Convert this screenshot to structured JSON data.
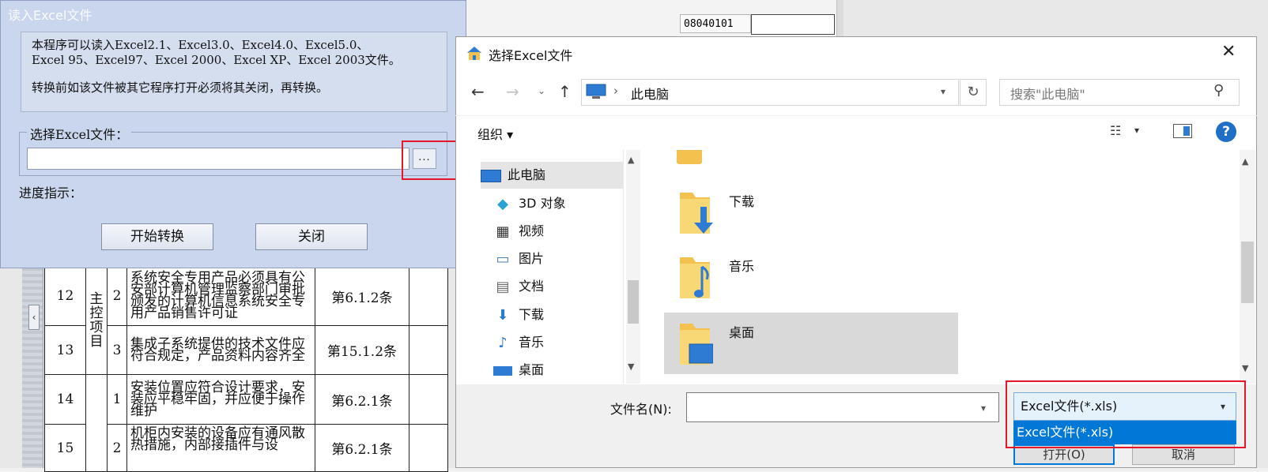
{
  "background": {
    "code_cell": "08040101",
    "table_rows": [
      {
        "no": "12",
        "category": "主\n控\n项\n目",
        "seq": "2",
        "desc": "系统安全专用产品必须具有公安部计算机管理监察部门审批颁发的计算机信息系统安全专用产品销售许可证",
        "ref": "第6.1.2条"
      },
      {
        "no": "13",
        "category": "",
        "seq": "3",
        "desc": "集成子系统提供的技术文件应符合规定，产品资料内容齐全",
        "ref": "第15.1.2条"
      },
      {
        "no": "14",
        "category": "",
        "seq": "1",
        "desc": "安装位置应符合设计要求，安装应平稳牢固，并应便于操作维护",
        "ref": "第6.2.1条"
      },
      {
        "no": "15",
        "category": "",
        "seq": "2",
        "desc": "机柜内安装的设备应有通风散热措施，内部接插件与设",
        "ref": "第6.2.1条"
      }
    ]
  },
  "excel_dialog": {
    "title": "读入Excel文件",
    "info_line1": "本程序可以读入Excel2.1、Excel3.0、Excel4.0、Excel5.0、",
    "info_line2": "Excel 95、Excel97、Excel 2000、Excel XP、Excel 2003文件。",
    "info_line3": "转换前如该文件被其它程序打开必须将其关闭，再转换。",
    "group_label": "选择Excel文件：",
    "file_path": "",
    "browse_label": "...",
    "progress_label": "进度指示：",
    "start_button": "开始转换",
    "close_button": "关闭"
  },
  "file_dialog": {
    "title": "选择Excel文件",
    "close_glyph": "✕",
    "address": "此电脑",
    "search_placeholder": "搜索\"此电脑\"",
    "organize": "组织 ▾",
    "nav_items": [
      {
        "label": "此电脑",
        "icon": "computer-icon"
      },
      {
        "label": "3D 对象",
        "icon": "cube-icon"
      },
      {
        "label": "视频",
        "icon": "video-icon"
      },
      {
        "label": "图片",
        "icon": "picture-icon"
      },
      {
        "label": "文档",
        "icon": "document-icon"
      },
      {
        "label": "下载",
        "icon": "download-icon"
      },
      {
        "label": "音乐",
        "icon": "music-icon"
      },
      {
        "label": "桌面",
        "icon": "desktop-icon"
      }
    ],
    "files": [
      {
        "name": "下载",
        "icon": "download-folder-icon"
      },
      {
        "name": "音乐",
        "icon": "music-folder-icon"
      },
      {
        "name": "桌面",
        "icon": "desktop-folder-icon"
      }
    ],
    "filename_label": "文件名(N):",
    "filename_value": "",
    "filetype_selected": "Excel文件(*.xls)",
    "filetype_option": "Excel文件(*.xls)",
    "open_button": "打开(O)",
    "cancel_button": "取消",
    "colors": {
      "accent": "#0078d7",
      "highlight": "#e3162c"
    }
  }
}
